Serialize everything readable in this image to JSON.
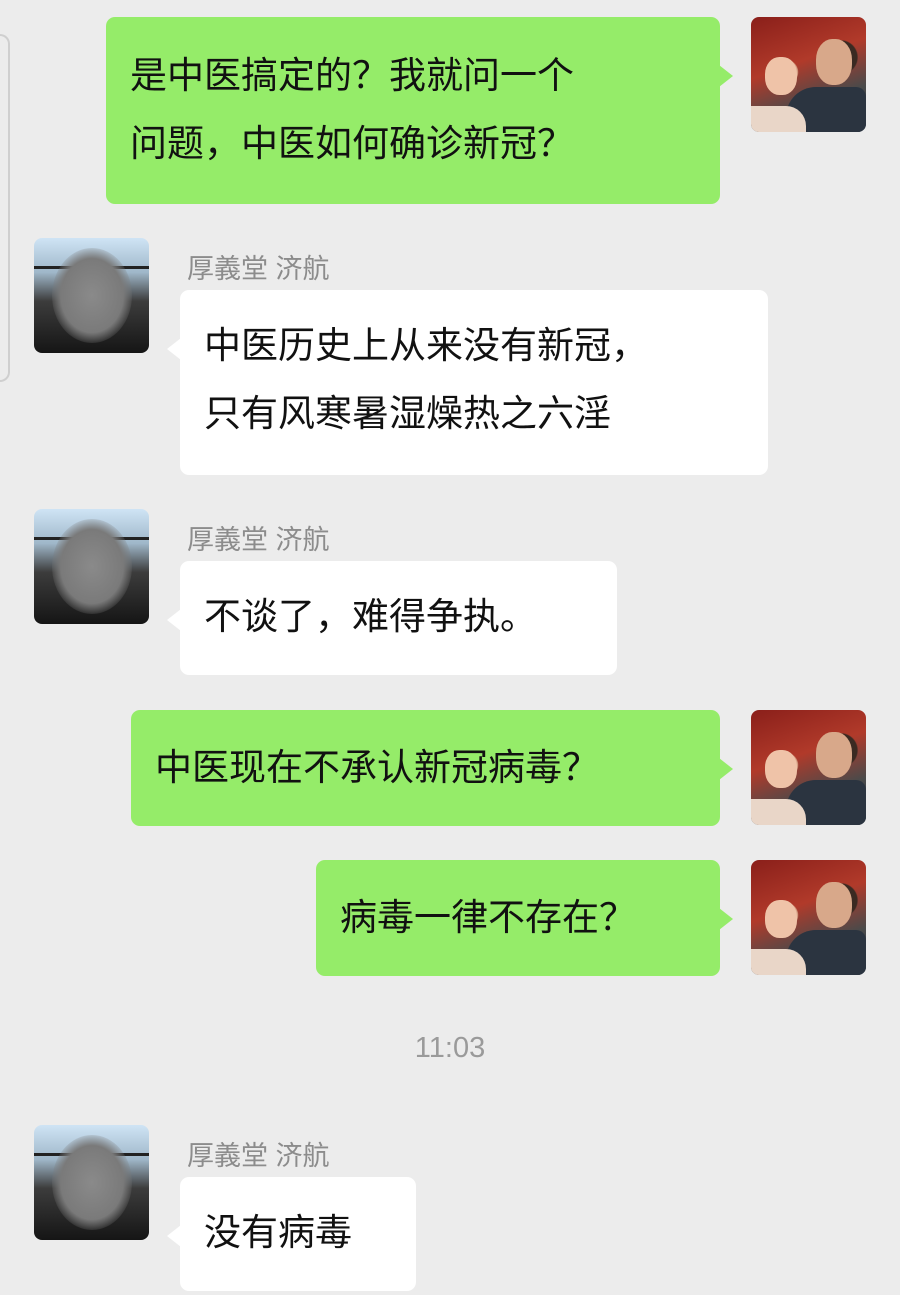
{
  "messages": [
    {
      "side": "out",
      "text": "是中医搞定的？我就问一个\n问题，中医如何确诊新冠？"
    },
    {
      "side": "in",
      "sender": "厚義堂 济航",
      "text": "中医历史上从来没有新冠，\n只有风寒暑湿燥热之六淫"
    },
    {
      "side": "in",
      "sender": "厚義堂 济航",
      "text": "不谈了，难得争执。"
    },
    {
      "side": "out",
      "text": "中医现在不承认新冠病毒？"
    },
    {
      "side": "out",
      "text": "病毒一律不存在？"
    },
    {
      "side": "in",
      "sender": "厚義堂 济航",
      "text": "没有病毒"
    }
  ],
  "timestamp": "11:03",
  "colors": {
    "outgoing_bubble": "#95ec69",
    "incoming_bubble": "#ffffff",
    "background": "#ececec"
  }
}
